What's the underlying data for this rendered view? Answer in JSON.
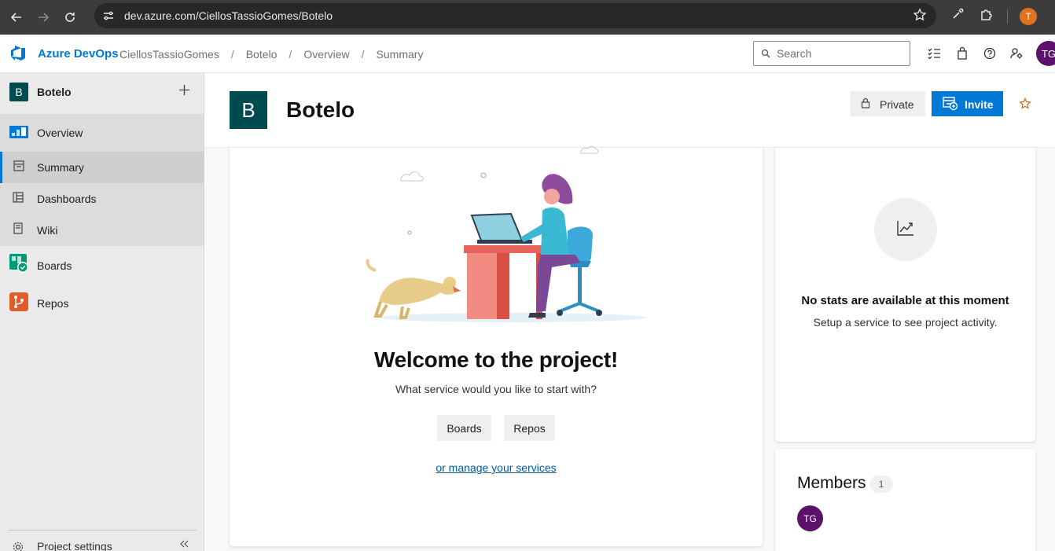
{
  "browser": {
    "url": "dev.azure.com/CiellosTassioGomes/Botelo",
    "profile_initial": "T"
  },
  "topbar": {
    "brand": "Azure DevOps",
    "breadcrumbs": [
      "CiellosTassioGomes",
      "Botelo",
      "Overview",
      "Summary"
    ],
    "search_placeholder": "Search",
    "user_initials": "TG"
  },
  "sidebar": {
    "project_initial": "B",
    "project_name": "Botelo",
    "items": [
      {
        "label": "Overview",
        "icon": "overview-icon"
      },
      {
        "label": "Summary",
        "icon": "summary-icon"
      },
      {
        "label": "Dashboards",
        "icon": "dashboards-icon"
      },
      {
        "label": "Wiki",
        "icon": "wiki-icon"
      },
      {
        "label": "Boards",
        "icon": "boards-icon"
      },
      {
        "label": "Repos",
        "icon": "repos-icon"
      }
    ],
    "settings_label": "Project settings"
  },
  "header": {
    "project_initial": "B",
    "title": "Botelo",
    "private_label": "Private",
    "invite_label": "Invite"
  },
  "welcome": {
    "title": "Welcome to the project!",
    "subtitle": "What service would you like to start with?",
    "boards_button": "Boards",
    "repos_button": "Repos",
    "manage_link": "or manage your services"
  },
  "stats": {
    "title": "No stats are available at this moment",
    "subtitle": "Setup a service to see project activity."
  },
  "members": {
    "title": "Members",
    "count": "1",
    "member_initials": "TG"
  },
  "colors": {
    "accent": "#0078d4",
    "project_badge": "#004b50",
    "avatar": "#5c126b"
  }
}
